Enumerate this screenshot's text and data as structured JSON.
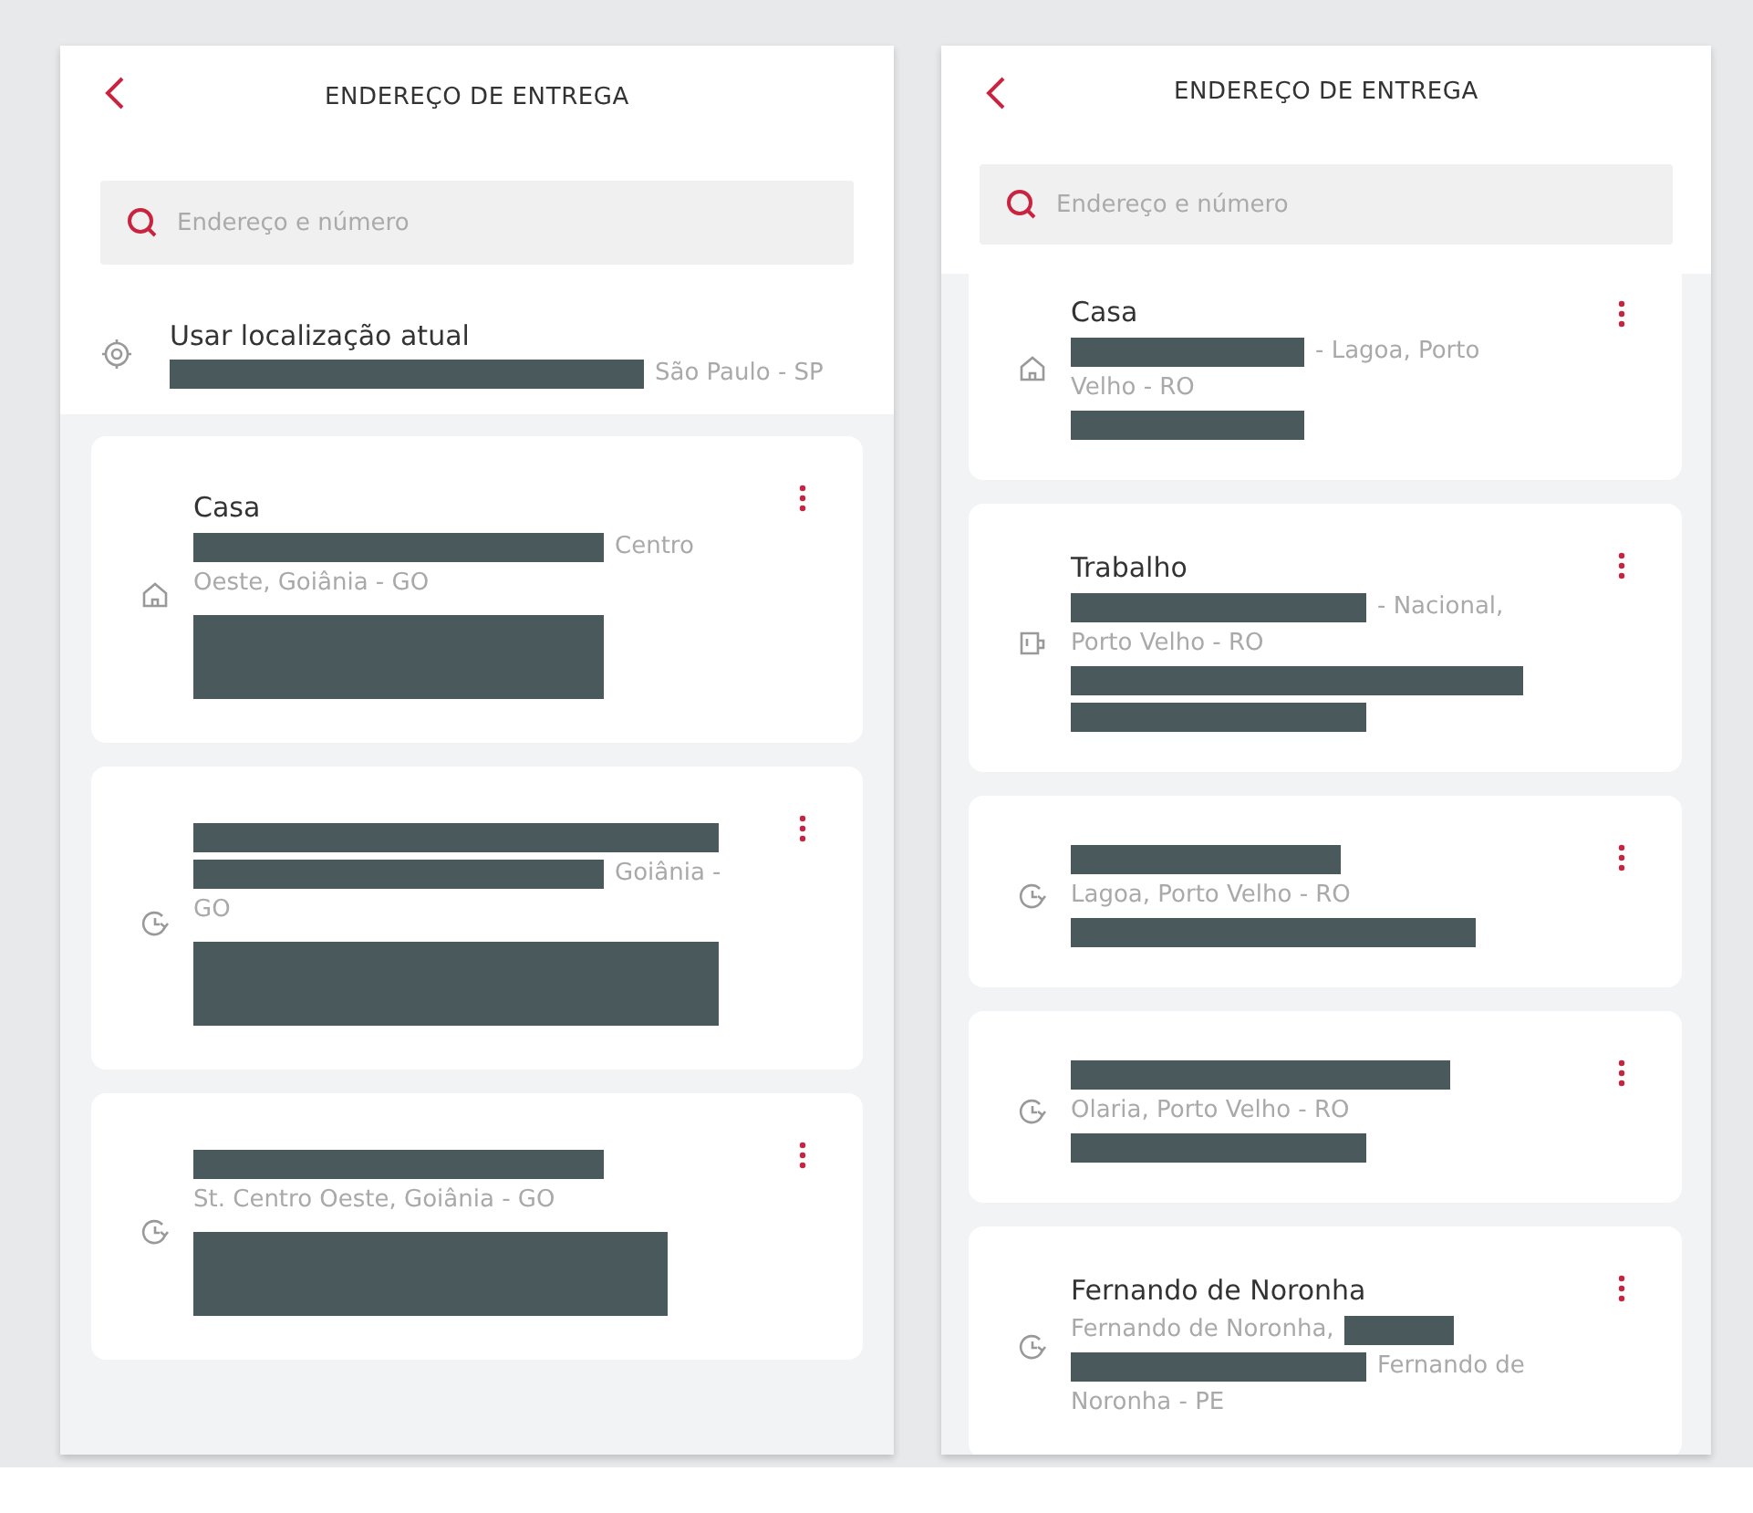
{
  "screens": [
    {
      "title": "ENDEREÇO DE ENTREGA",
      "search": {
        "placeholder": "Endereço e número"
      },
      "current_location": {
        "label": "Usar localização atual",
        "lines": [
          [
            {
              "kind": "redacted"
            },
            {
              "kind": "text",
              "text": "São Paulo - SP"
            }
          ]
        ]
      },
      "addresses": [
        {
          "kind": "home",
          "name": "Casa",
          "lines": [
            [
              {
                "kind": "redacted"
              },
              {
                "kind": "text",
                "text": "Centro"
              }
            ],
            [
              {
                "kind": "text",
                "text": "Oeste, Goiânia - GO"
              }
            ],
            [
              {
                "kind": "block"
              }
            ]
          ]
        },
        {
          "kind": "recent",
          "lines": [
            [
              {
                "kind": "redacted"
              }
            ],
            [
              {
                "kind": "redacted"
              },
              {
                "kind": "text",
                "text": "Goiânia -"
              }
            ],
            [
              {
                "kind": "text",
                "text": "GO"
              }
            ],
            [
              {
                "kind": "block"
              }
            ]
          ]
        },
        {
          "kind": "recent",
          "lines": [
            [
              {
                "kind": "redacted"
              }
            ],
            [
              {
                "kind": "text",
                "text": "St. Centro Oeste, Goiânia - GO"
              }
            ],
            [
              {
                "kind": "block"
              }
            ]
          ]
        }
      ]
    },
    {
      "title": "ENDEREÇO DE ENTREGA",
      "search": {
        "placeholder": "Endereço e número"
      },
      "addresses": [
        {
          "kind": "home",
          "name": "Casa",
          "lines": [
            [
              {
                "kind": "redacted"
              },
              {
                "kind": "text",
                "text": "- Lagoa, Porto"
              }
            ],
            [
              {
                "kind": "text",
                "text": "Velho - RO"
              }
            ],
            [
              {
                "kind": "redacted"
              }
            ]
          ]
        },
        {
          "kind": "work",
          "name": "Trabalho",
          "lines": [
            [
              {
                "kind": "redacted"
              },
              {
                "kind": "text",
                "text": "- Nacional,"
              }
            ],
            [
              {
                "kind": "text",
                "text": "Porto Velho - RO"
              }
            ],
            [
              {
                "kind": "redacted"
              }
            ],
            [
              {
                "kind": "redacted"
              }
            ]
          ]
        },
        {
          "kind": "recent",
          "lines": [
            [
              {
                "kind": "redacted"
              }
            ],
            [
              {
                "kind": "text",
                "text": "Lagoa, Porto Velho - RO"
              }
            ],
            [
              {
                "kind": "redacted"
              }
            ]
          ]
        },
        {
          "kind": "recent",
          "lines": [
            [
              {
                "kind": "redacted"
              }
            ],
            [
              {
                "kind": "text",
                "text": "Olaria, Porto Velho - RO"
              }
            ],
            [
              {
                "kind": "redacted"
              }
            ]
          ]
        },
        {
          "kind": "recent",
          "name": "Fernando de Noronha",
          "lines": [
            [
              {
                "kind": "text",
                "text": "Fernando de Noronha,"
              },
              {
                "kind": "redacted"
              }
            ],
            [
              {
                "kind": "redacted"
              },
              {
                "kind": "text",
                "text": "Fernando de"
              }
            ],
            [
              {
                "kind": "text",
                "text": "Noronha - PE"
              }
            ]
          ]
        }
      ]
    }
  ]
}
